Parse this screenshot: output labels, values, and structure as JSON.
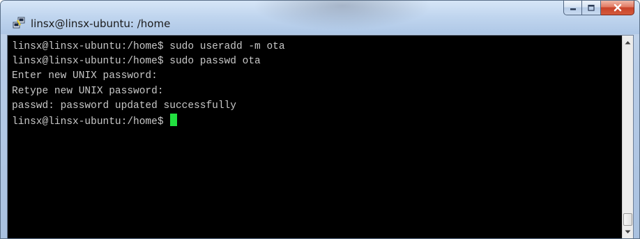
{
  "window": {
    "title": "linsx@linsx-ubuntu: /home",
    "app_icon": "putty-icon"
  },
  "caption_buttons": {
    "minimize": "minimize-icon",
    "maximize": "maximize-icon",
    "close": "close-icon"
  },
  "terminal": {
    "background": "#000000",
    "text_color": "#c8c8c8",
    "cursor_color": "#22e040",
    "lines": [
      "linsx@linsx-ubuntu:/home$ sudo useradd -m ota",
      "linsx@linsx-ubuntu:/home$ sudo passwd ota",
      "Enter new UNIX password:",
      "Retype new UNIX password:",
      "passwd: password updated successfully"
    ],
    "prompt": "linsx@linsx-ubuntu:/home$ "
  }
}
